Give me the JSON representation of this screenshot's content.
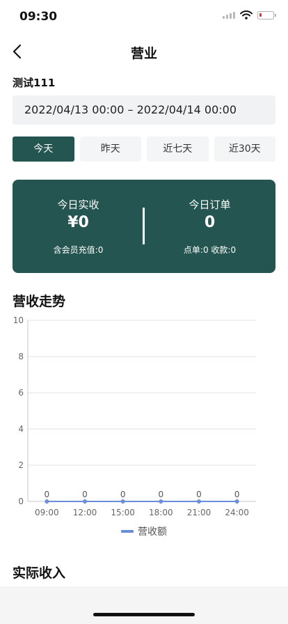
{
  "status_bar": {
    "time": "09:30"
  },
  "nav": {
    "title": "营业"
  },
  "store": {
    "name": "测试111"
  },
  "date_range": {
    "text": "2022/04/13 00:00 – 2022/04/14 00:00"
  },
  "tabs": [
    {
      "label": "今天",
      "active": true
    },
    {
      "label": "昨天",
      "active": false
    },
    {
      "label": "近七天",
      "active": false
    },
    {
      "label": "近30天",
      "active": false
    }
  ],
  "summary": {
    "left": {
      "label": "今日实收",
      "value": "¥0",
      "sub": "含会员充值:0"
    },
    "right": {
      "label": "今日订单",
      "value": "0",
      "sub": "点单:0 收款:0"
    }
  },
  "sections": {
    "trend_title": "营收走势",
    "income_title": "实际收入"
  },
  "colors": {
    "brand": "#255550",
    "series": "#6a8fd8"
  },
  "chart_data": {
    "type": "line",
    "x": [
      "09:00",
      "12:00",
      "15:00",
      "18:00",
      "21:00",
      "24:00"
    ],
    "series": [
      {
        "name": "营收额",
        "values": [
          0,
          0,
          0,
          0,
          0,
          0
        ]
      }
    ],
    "ylim": [
      0,
      10
    ],
    "yticks": [
      0,
      2,
      4,
      6,
      8,
      10
    ],
    "grid": true,
    "legend": "bottom"
  }
}
